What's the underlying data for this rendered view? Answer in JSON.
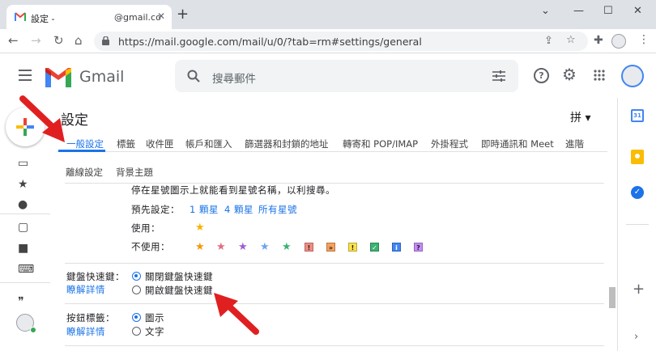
{
  "browser": {
    "tab_title": "設定 -",
    "tab_account": "@gmail.co",
    "url": "https://mail.google.com/mail/u/0/?tab=rm#settings/general"
  },
  "header": {
    "app_name": "Gmail",
    "search_placeholder": "搜尋郵件"
  },
  "settings": {
    "title": "設定",
    "input_lang": "拼 ▾",
    "tabs": [
      "一般設定",
      "標籤",
      "收件匣",
      "帳戶和匯入",
      "篩選器和封鎖的地址",
      "轉寄和 POP/IMAP",
      "外掛程式",
      "即時通訊和 Meet",
      "進階"
    ],
    "subtabs": [
      "離線設定",
      "背景主題"
    ],
    "stars": {
      "desc": "停在星號圖示上就能看到星號名稱，以利搜尋。",
      "preset_label": "預先設定：",
      "preset_options": [
        "1 顆星",
        "4 顆星",
        "所有星號"
      ],
      "in_use_label": "使用：",
      "not_in_use_label": "不使用："
    },
    "shortcuts": {
      "label": "鍵盤快速鍵：",
      "learn_more": "瞭解詳情",
      "off": "關閉鍵盤快速鍵",
      "on": "開啟鍵盤快速鍵",
      "selected": "off"
    },
    "button_labels": {
      "label": "按鈕標籤：",
      "learn_more": "瞭解詳情",
      "icons": "圖示",
      "text": "文字",
      "selected": "icons"
    }
  },
  "colors": {
    "accent": "#1a73e8",
    "annotation_arrow": "#e02020"
  }
}
